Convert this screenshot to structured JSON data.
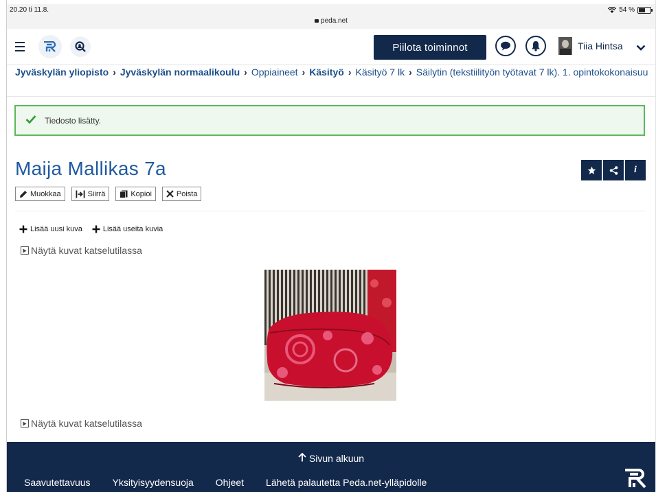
{
  "status_bar": {
    "time": "20.20  ti 11.8.",
    "url": "peda.net",
    "battery": "54 %"
  },
  "topnav": {
    "hide_button": "Piilota toiminnot",
    "user_name": "Tiia Hintsa"
  },
  "breadcrumb": [
    {
      "label": "Jyväskylän yliopisto",
      "bold": true
    },
    {
      "label": "Jyväskylän normaalikoulu",
      "bold": true
    },
    {
      "label": "Oppiaineet",
      "bold": false
    },
    {
      "label": "Käsityö",
      "bold": true
    },
    {
      "label": "Käsityö 7 lk",
      "bold": false
    },
    {
      "label": "Säilytin (tekstiilityön työtavat 7 lk). 1. opintokokonaisuu",
      "bold": false
    }
  ],
  "alert": {
    "message": "Tiedosto lisätty."
  },
  "page": {
    "title": "Maija Mallikas 7a",
    "info_label": "i"
  },
  "toolbar": {
    "edit": "Muokkaa",
    "move": "Siirrä",
    "copy": "Kopioi",
    "delete": "Poista"
  },
  "add_actions": {
    "add_one": "Lisää uusi kuva",
    "add_many": "Lisää useita kuvia"
  },
  "gallery": {
    "view_link": "Näytä kuvat katselutilassa"
  },
  "footer": {
    "back_to_top": "Sivun alkuun",
    "links": [
      "Saavutettavuus",
      "Yksityisyydensuoja",
      "Ohjeet",
      "Lähetä palautetta Peda.net-ylläpidolle"
    ]
  },
  "colors": {
    "navy": "#13294b",
    "link_blue": "#1f5aa0",
    "success_border": "#5cb85c"
  }
}
